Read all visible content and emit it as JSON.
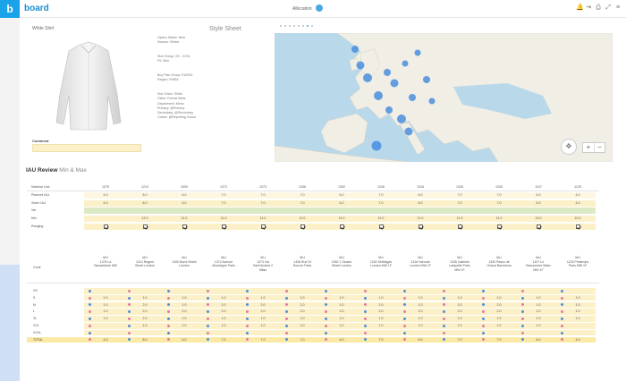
{
  "app": {
    "logo": "b",
    "brand": "board",
    "breadcrumb": "Allocation"
  },
  "top_icons": [
    "bell-icon",
    "export-icon",
    "print-icon",
    "expand-icon",
    "menu-icon"
  ],
  "shirt_panel": {
    "title": "White Shirt",
    "comment_label": "Comment"
  },
  "style_sheet": {
    "title": "Style Sheet",
    "groups": [
      [
        "Option Status: New",
        "Season: Winter"
      ],
      [
        "Size Group: XS - XXXL",
        "Fit: Slim"
      ],
      [
        "Buy Plan Group: EURO1",
        "Region: EMEA"
      ],
      [
        "Sub-Class: Shirts",
        "Class: Formal Wear",
        "Department: Mens",
        "Primary: @Primary",
        "Secondary: @Secondary",
        "Colour: @Reporting Colour"
      ]
    ]
  },
  "map": {
    "zoom_in": "+",
    "zoom_out": "−"
  },
  "review": {
    "title": "IAU Review",
    "subtitle": "Min & Max"
  },
  "table1": {
    "header_label": "Material Link",
    "columns": [
      "1375",
      "1214",
      "1000",
      "1372",
      "1373",
      "1336",
      "1352",
      "1240",
      "1316",
      "1335",
      "1330",
      "1107",
      "1125"
    ],
    "rows": [
      {
        "label": "Planned IAU",
        "values": [
          "4.0",
          "8.0",
          "6.0",
          "7.0",
          "7.0",
          "7.0",
          "6.0",
          "7.0",
          "6.0",
          "7.0",
          "7.0",
          "6.0",
          "4.0"
        ]
      },
      {
        "label": "Siden IAU",
        "values": [
          "4.0",
          "8.0",
          "6.0",
          "7.0",
          "7.0",
          "7.0",
          "6.0",
          "7.0",
          "6.0",
          "7.0",
          "7.0",
          "6.0",
          "4.0"
        ]
      },
      {
        "label": "Var",
        "values": [
          "",
          "",
          "",
          "",
          "",
          "",
          "",
          "",
          "",
          "",
          "",
          "",
          ""
        ]
      },
      {
        "label": "Min",
        "values": [
          "",
          "12.0",
          "11.0",
          "11.0",
          "11.0",
          "11.0",
          "11.0",
          "11.0",
          "11.0",
          "11.0",
          "11.0",
          "10.0",
          "10.0"
        ]
      },
      {
        "label": "Ranging",
        "values": [
          "x",
          "x",
          "x",
          "x",
          "x",
          "x",
          "x",
          "x",
          "x",
          "x",
          "x",
          "x",
          "x"
        ]
      }
    ]
  },
  "table2": {
    "code_label": "Code",
    "columns": [
      [
        "IAU",
        "1375 La",
        "Samaritaine MW"
      ],
      [
        "IAU",
        "1214 Regent",
        "Street London"
      ],
      [
        "IAU",
        "1000 Bond Street",
        "London"
      ],
      [
        "IAU",
        "1372 Avenue",
        "Montaigne Paris"
      ],
      [
        "IAU",
        "1373 Via",
        "Sant'Andrea 2",
        "Milan"
      ],
      [
        "IAU",
        "1336 Rue St",
        "Honore Paris"
      ],
      [
        "IAU",
        "1352 1 Sloane",
        "Street London"
      ],
      [
        "IAU",
        "1240 Selfridges",
        "London MW 1F"
      ],
      [
        "IAU",
        "1316 Harrods",
        "London MW 1F"
      ],
      [
        "IAU",
        "1335 Galeries",
        "Lafayette Paris",
        "MW 1F"
      ],
      [
        "IAU",
        "1330 Paseo de",
        "Gracia Barcelona"
      ],
      [
        "IAU",
        "1107 Le",
        "Beaucentre Milan",
        "MW 1F"
      ],
      [
        "IAU",
        "1125 Printemps",
        "Paris MW 1F"
      ]
    ],
    "rows": [
      {
        "label": "XS",
        "values": [
          "",
          "",
          "",
          "",
          "",
          "",
          "",
          "",
          "",
          "",
          "",
          "",
          ""
        ]
      },
      {
        "label": "S",
        "values": [
          "1.0",
          "1.0",
          "1.0",
          "1.0",
          "1.0",
          "1.0",
          "1.0",
          "1.0",
          "1.0",
          "1.0",
          "1.0",
          "1.0",
          "1.0"
        ]
      },
      {
        "label": "M",
        "values": [
          "1.0",
          "2.0",
          "1.0",
          "2.0",
          "2.0",
          "2.0",
          "1.0",
          "2.0",
          "1.0",
          "2.0",
          "2.0",
          "1.0",
          "1.0"
        ]
      },
      {
        "label": "L",
        "values": [
          "1.0",
          "2.0",
          "2.0",
          "2.0",
          "2.0",
          "2.0",
          "2.0",
          "2.0",
          "2.0",
          "2.0",
          "2.0",
          "2.0",
          "1.0"
        ]
      },
      {
        "label": "XL",
        "values": [
          "1.0",
          "2.0",
          "1.0",
          "1.0",
          "1.0",
          "1.0",
          "1.0",
          "1.0",
          "1.0",
          "1.0",
          "1.0",
          "1.0",
          "1.0"
        ]
      },
      {
        "label": "XXL",
        "values": [
          "",
          "1.0",
          "1.0",
          "1.0",
          "1.0",
          "1.0",
          "1.0",
          "1.0",
          "1.0",
          "1.0",
          "1.0",
          "1.0",
          ""
        ]
      },
      {
        "label": "XXXL",
        "values": [
          "",
          "",
          "",
          "",
          "",
          "",
          "",
          "",
          "",
          "",
          "",
          "",
          ""
        ]
      },
      {
        "label": "TOTAL",
        "values": [
          "4.0",
          "8.0",
          "6.0",
          "7.0",
          "7.0",
          "7.0",
          "6.0",
          "7.0",
          "6.0",
          "7.0",
          "7.0",
          "6.0",
          "4.0"
        ]
      }
    ]
  },
  "colors": {
    "accent": "#1aa3e8",
    "input_yellow": "#fbf0c8",
    "var_green": "#dbe9c4",
    "dot_blue": "#4a8fe0",
    "dot_pink": "#e27aa6",
    "map_sea": "#b9d8ea",
    "map_land": "#f1eee6"
  }
}
